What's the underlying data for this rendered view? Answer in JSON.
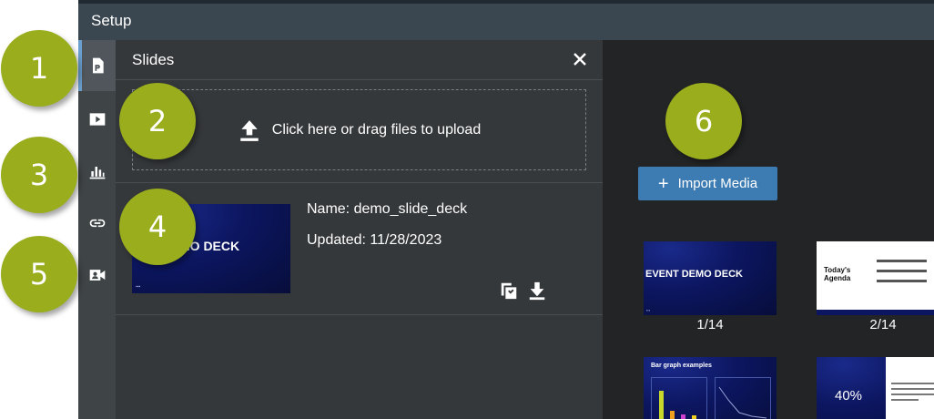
{
  "window": {
    "title": "Setup"
  },
  "rail": [
    {
      "id": "slides",
      "icon": "presentation-icon",
      "active": true
    },
    {
      "id": "video",
      "icon": "play-video-icon",
      "active": false
    },
    {
      "id": "polls",
      "icon": "bar-chart-icon",
      "active": false
    },
    {
      "id": "links",
      "icon": "link-icon",
      "active": false
    },
    {
      "id": "camera",
      "icon": "video-camera-icon",
      "active": false
    }
  ],
  "slides_panel": {
    "title": "Slides",
    "upload_text": "Click here or drag files to upload",
    "deck": {
      "thumb_text": "MO DECK",
      "name": "Name: demo_slide_deck",
      "updated": "Updated: 11/28/2023"
    }
  },
  "media": {
    "import_label": "Import Media",
    "slides": [
      {
        "label": "1/14",
        "title": "EVENT DEMO DECK"
      },
      {
        "label": "2/14",
        "title": "Today's Agenda"
      },
      {
        "label": "",
        "title": "Bar graph examples"
      },
      {
        "label": "",
        "title": "40%"
      }
    ]
  },
  "badges": [
    "1",
    "2",
    "3",
    "4",
    "5",
    "6"
  ],
  "colors": {
    "accent": "#3d7bb3",
    "badge": "#9aad1c",
    "topbar": "#3a4650",
    "panel": "#35383b"
  }
}
